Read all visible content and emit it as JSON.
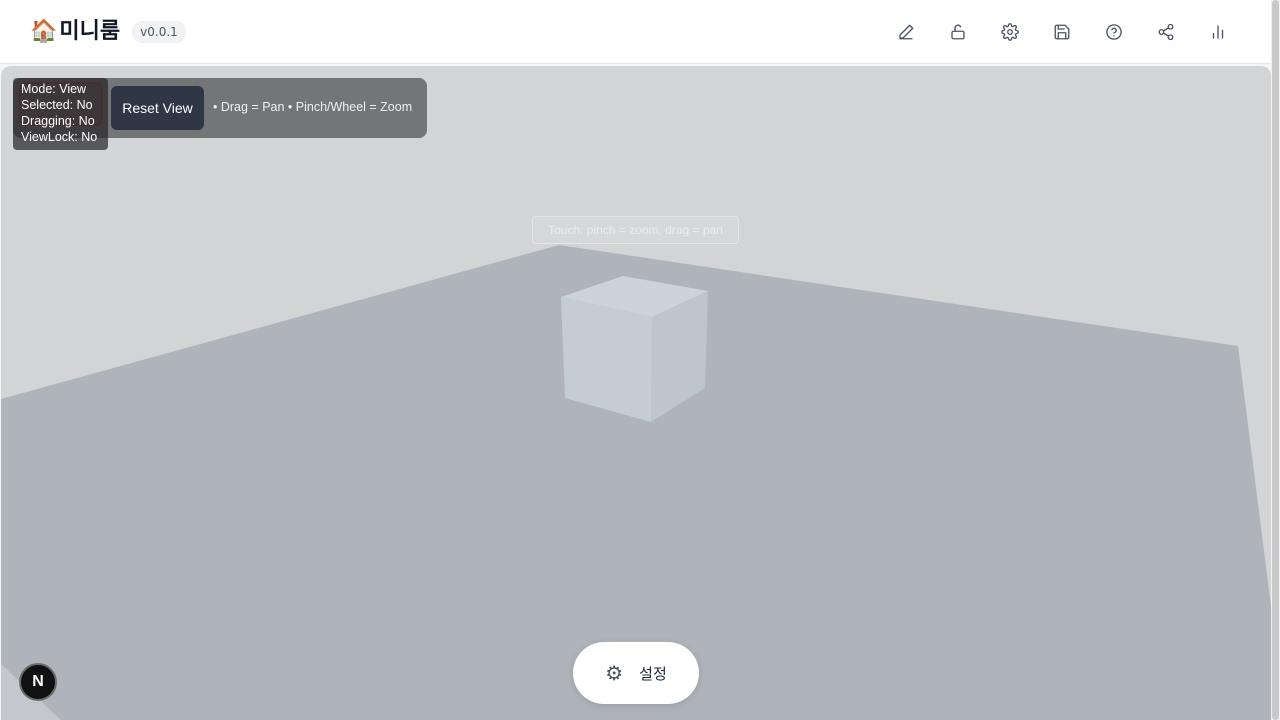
{
  "header": {
    "brand_emoji": "🏠",
    "title": "미니룸",
    "version": "v0.0.1",
    "toolbar": [
      {
        "icon": "pencil-icon"
      },
      {
        "icon": "unlock-icon"
      },
      {
        "icon": "gear-icon"
      },
      {
        "icon": "save-icon"
      },
      {
        "icon": "help-icon"
      },
      {
        "icon": "share-icon"
      },
      {
        "icon": "stats-icon"
      }
    ]
  },
  "viewport": {
    "reset_label": "Reset View",
    "hint": "• Drag = Pan • Pinch/Wheel = Zoom",
    "touch_hint": "Touch: pinch = zoom, drag = pan",
    "debug": {
      "mode": "Mode: View",
      "selected": "Selected: No",
      "dragging": "Dragging: No",
      "viewlock": "ViewLock: No"
    }
  },
  "settings": {
    "icon": "gear-icon",
    "label": "설정"
  },
  "corner_badge": "N",
  "colors": {
    "sky": "#d3d4d6",
    "floor": "#afb4bb",
    "cube": "#c3ccd3",
    "accent": "#2f3645"
  }
}
